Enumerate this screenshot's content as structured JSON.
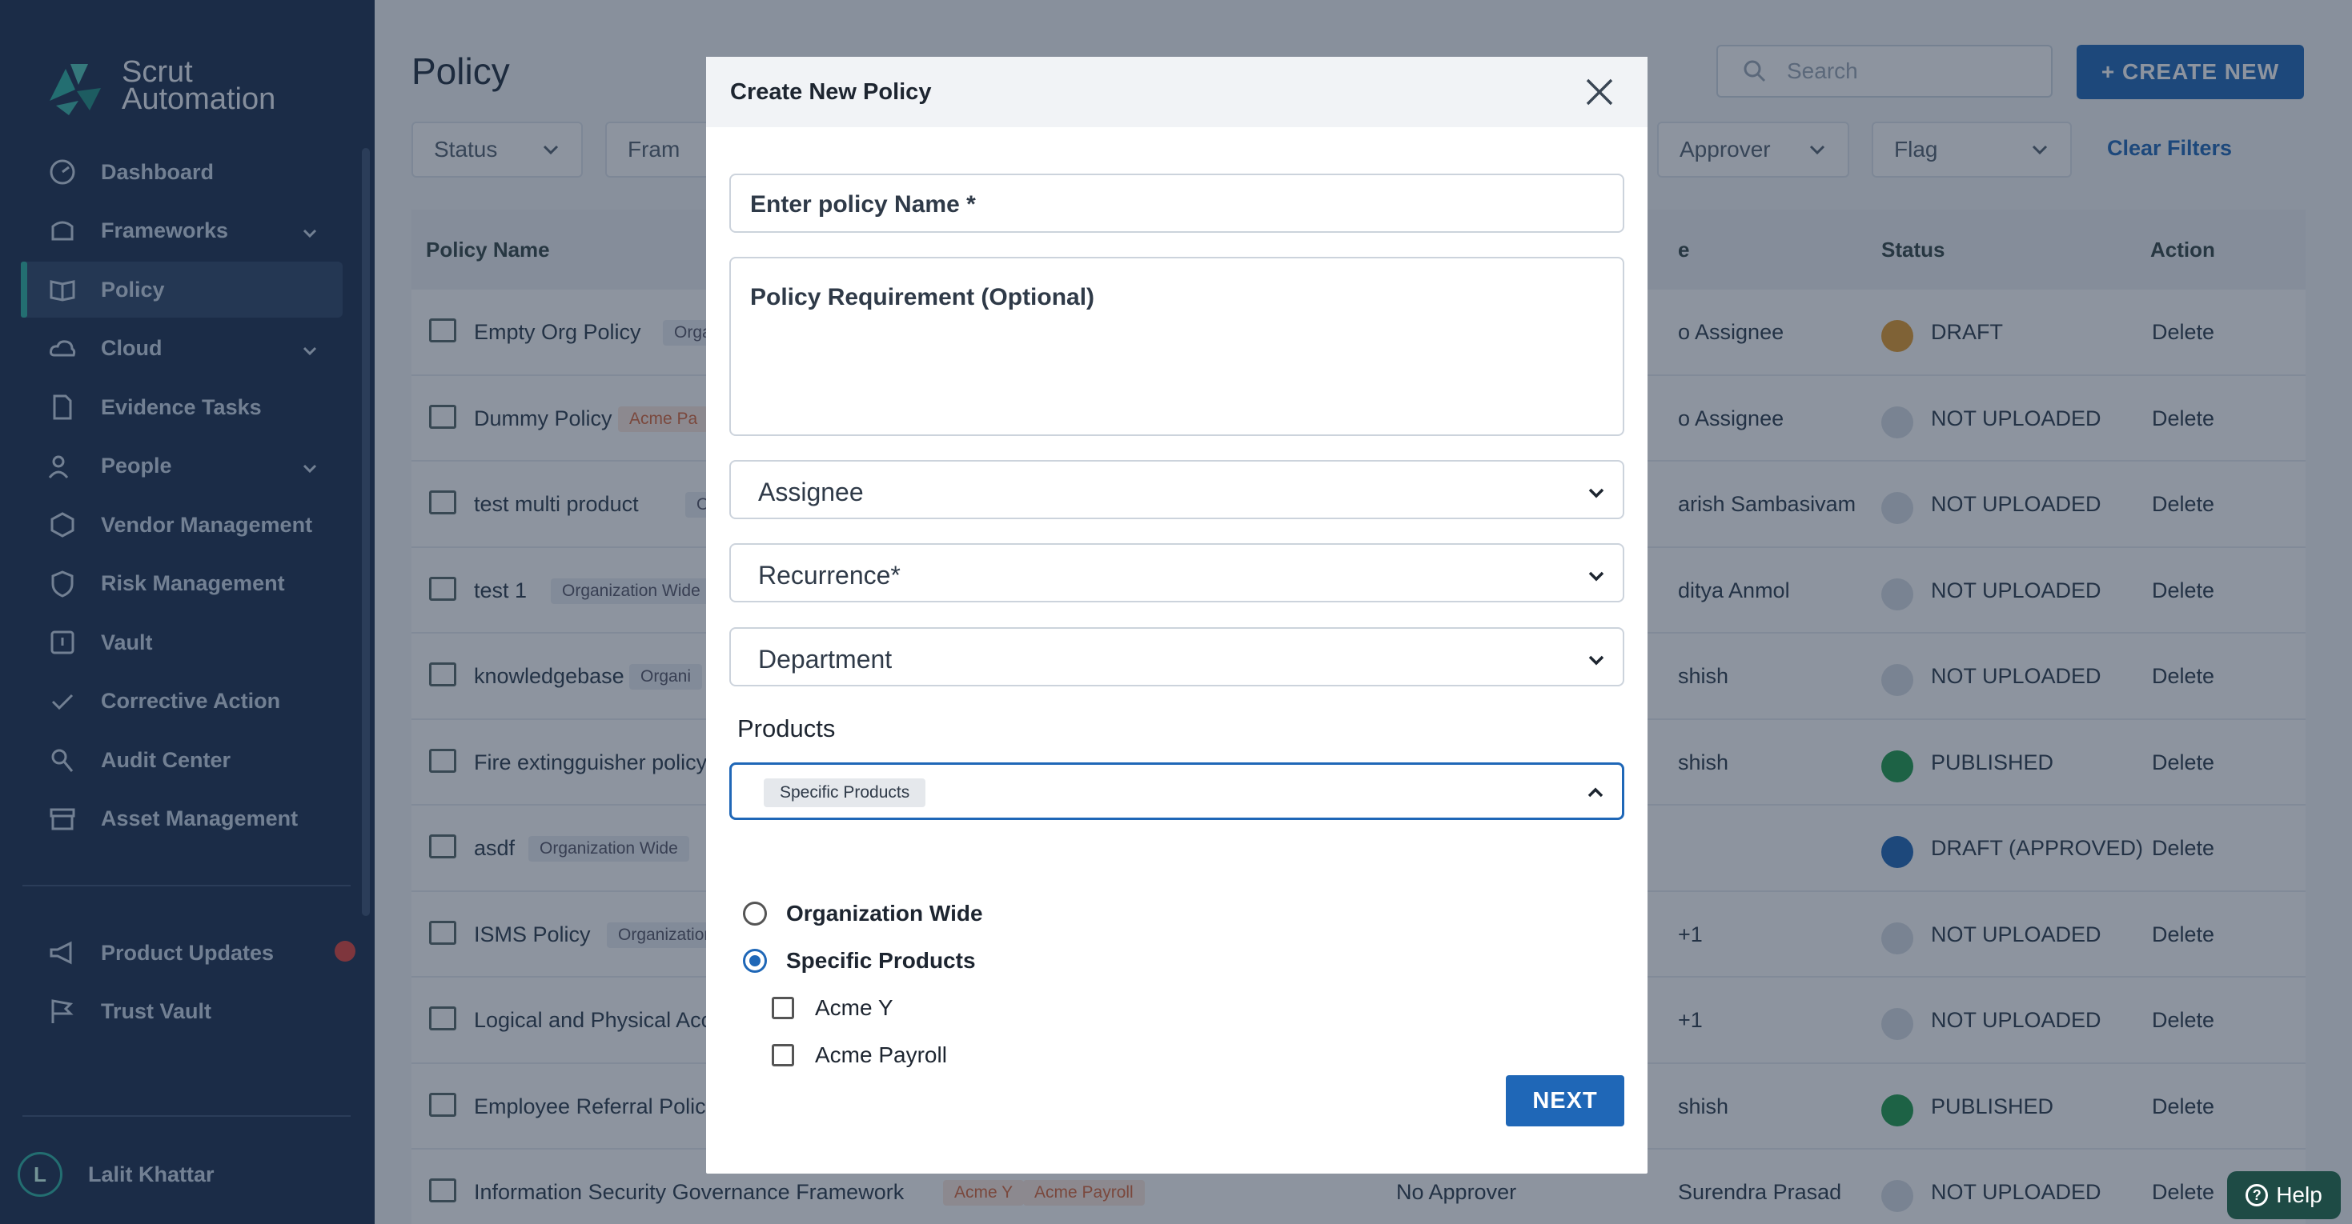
{
  "sidebar": {
    "logo_line1": "Scrut",
    "logo_line2": "Automation",
    "items": [
      {
        "label": "Dashboard",
        "icon": "dashboard-icon",
        "chevron": false
      },
      {
        "label": "Frameworks",
        "icon": "framework-icon",
        "chevron": true
      },
      {
        "label": "Policy",
        "icon": "book-icon",
        "chevron": false,
        "active": true
      },
      {
        "label": "Cloud",
        "icon": "cloud-icon",
        "chevron": true
      },
      {
        "label": "Evidence Tasks",
        "icon": "document-icon",
        "chevron": false
      },
      {
        "label": "People",
        "icon": "people-icon",
        "chevron": true
      },
      {
        "label": "Vendor Management",
        "icon": "vendor-icon",
        "chevron": false
      },
      {
        "label": "Risk Management",
        "icon": "shield-icon",
        "chevron": false
      },
      {
        "label": "Vault",
        "icon": "vault-icon",
        "chevron": false
      },
      {
        "label": "Corrective Action",
        "icon": "check-icon",
        "chevron": false
      },
      {
        "label": "Audit Center",
        "icon": "audit-icon",
        "chevron": false
      },
      {
        "label": "Asset Management",
        "icon": "archive-icon",
        "chevron": false
      }
    ],
    "bottom_items": [
      {
        "label": "Product Updates",
        "icon": "megaphone-icon"
      },
      {
        "label": "Trust Vault",
        "icon": "flag-icon"
      }
    ],
    "user": {
      "initial": "L",
      "name": "Lalit Khattar"
    }
  },
  "page": {
    "title": "Policy",
    "search_placeholder": "Search",
    "create_label": "+ CREATE NEW",
    "filters": [
      "Status",
      "Fram",
      "Approver",
      "Flag"
    ],
    "clear_filters": "Clear Filters",
    "columns": [
      "Policy Name",
      "e",
      "Status",
      "Action"
    ],
    "rows": [
      {
        "name": "Empty Org Policy",
        "tag": "Orga",
        "tag_style": "grey",
        "assignee": "o Assignee",
        "status": "DRAFT",
        "status_color": "#e39a2d"
      },
      {
        "name": "Dummy Policy",
        "tag": "Acme Pa",
        "tag_style": "orange",
        "assignee": "o Assignee",
        "status": "NOT UPLOADED",
        "status_color": "#d7dde4"
      },
      {
        "name": "test multi product",
        "tag": "Org",
        "tag_style": "grey",
        "assignee": "arish Sambasivam",
        "status": "NOT UPLOADED",
        "status_color": "#d7dde4"
      },
      {
        "name": "test 1",
        "tag": "Organization Wide",
        "tag_style": "grey",
        "assignee": "ditya Anmol",
        "status": "NOT UPLOADED",
        "status_color": "#d7dde4"
      },
      {
        "name": "knowledgebase",
        "tag": "Organi",
        "tag_style": "grey",
        "assignee": "shish",
        "status": "NOT UPLOADED",
        "status_color": "#d7dde4"
      },
      {
        "name": "Fire extingguisher policy",
        "tag": "",
        "tag_style": "grey",
        "assignee": "shish",
        "status": "PUBLISHED",
        "status_color": "#1f9a4a"
      },
      {
        "name": "asdf",
        "tag": "Organization Wide",
        "tag_style": "grey",
        "assignee": "",
        "status": "DRAFT (APPROVED)",
        "status_color": "#1f67b7"
      },
      {
        "name": "ISMS Policy",
        "tag": "Organization",
        "tag_style": "grey",
        "assignee": "+1",
        "status": "NOT UPLOADED",
        "status_color": "#d7dde4"
      },
      {
        "name": "Logical and Physical Acc",
        "tag": "",
        "tag_style": "grey",
        "assignee": "+1",
        "status": "NOT UPLOADED",
        "status_color": "#d7dde4"
      },
      {
        "name": "Employee Referral Policy",
        "tag": "",
        "tag_style": "grey",
        "assignee": "shish",
        "status": "PUBLISHED",
        "status_color": "#1f9a4a"
      },
      {
        "name": "Information Security Governance Framework",
        "tag": "Acme Y",
        "tag_style": "orange",
        "tag2": "Acme Payroll",
        "approver": "No Approver",
        "assignee": "Surendra Prasad",
        "status": "NOT UPLOADED",
        "status_color": "#d7dde4"
      }
    ],
    "delete_label": "Delete"
  },
  "modal": {
    "title": "Create New Policy",
    "name_placeholder": "Enter policy Name *",
    "requirement_placeholder": "Policy Requirement (Optional)",
    "assignee_label": "Assignee",
    "recurrence_label": "Recurrence*",
    "department_label": "Department",
    "products_label": "Products",
    "products_chip": "Specific Products",
    "radio_org": "Organization Wide",
    "radio_specific": "Specific Products",
    "product_options": [
      "Acme Y",
      "Acme Payroll"
    ],
    "next_label": "NEXT"
  },
  "help_label": "Help"
}
